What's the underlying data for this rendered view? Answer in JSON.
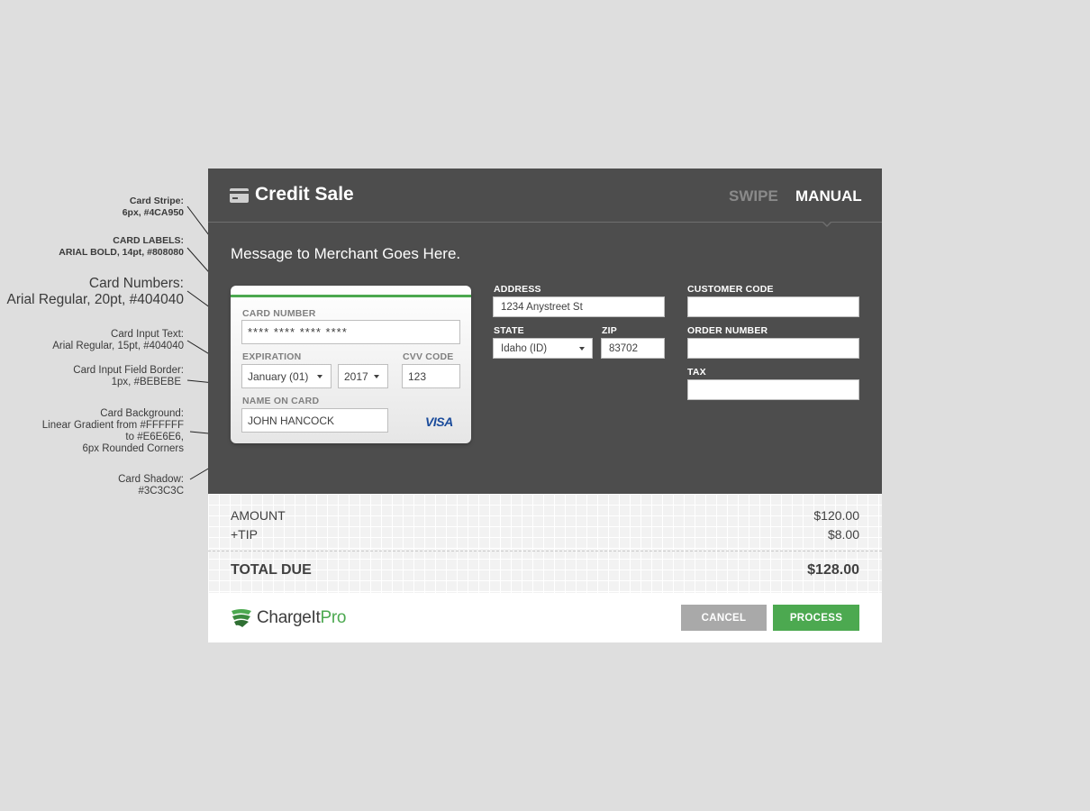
{
  "annotations": {
    "card_stripe": [
      "Card Stripe:",
      "6px, #4CA950"
    ],
    "card_labels": [
      "CARD LABELS:",
      "ARIAL BOLD, 14pt, #808080"
    ],
    "card_numbers": [
      "Card Numbers:",
      "Arial Regular, 20pt, #404040"
    ],
    "card_input_text": [
      "Card Input Text:",
      "Arial Regular, 15pt, #404040"
    ],
    "card_input_border": [
      "Card Input Field Border:",
      "1px, #BEBEBE"
    ],
    "card_background": [
      "Card Background:",
      "Linear Gradient from #FFFFFF",
      "to #E6E6E6,",
      "6px Rounded Corners"
    ],
    "card_shadow": [
      "Card Shadow:",
      "#3C3C3C"
    ]
  },
  "header": {
    "icon": "credit-card-icon",
    "title": "Credit Sale",
    "tabs": [
      {
        "label": "SWIPE",
        "active": false
      },
      {
        "label": "MANUAL",
        "active": true
      }
    ]
  },
  "message": "Message to Merchant Goes Here.",
  "card": {
    "card_number_label": "CARD NUMBER",
    "card_number_value": "**** **** **** ****",
    "expiration_label": "EXPIRATION",
    "exp_month": "January (01)",
    "exp_year": "2017",
    "cvv_label": "CVV CODE",
    "cvv_value": "123",
    "name_label": "NAME ON CARD",
    "name_value": "JOHN HANCOCK",
    "brand": "VISA"
  },
  "fields": {
    "address_label": "ADDRESS",
    "address_value": "1234 Anystreet St",
    "state_label": "STATE",
    "state_value": "Idaho (ID)",
    "zip_label": "ZIP",
    "zip_value": "83702",
    "customer_code_label": "CUSTOMER CODE",
    "customer_code_value": "",
    "order_number_label": "ORDER NUMBER",
    "order_number_value": "",
    "tax_label": "TAX",
    "tax_value": ""
  },
  "totals": {
    "amount_label": "AMOUNT",
    "amount_value": "$120.00",
    "tip_label": "+TIP",
    "tip_value": "$8.00",
    "total_label": "TOTAL DUE",
    "total_value": "$128.00"
  },
  "footer": {
    "logo_main": "ChargeIt",
    "logo_accent": "Pro",
    "cancel_label": "CANCEL",
    "process_label": "PROCESS"
  },
  "colors": {
    "stripe": "#4CA950",
    "card_labels": "#808080",
    "card_text": "#404040",
    "input_border": "#BEBEBE",
    "card_shadow": "#3C3C3C",
    "header_bg": "#4D4D4D"
  }
}
